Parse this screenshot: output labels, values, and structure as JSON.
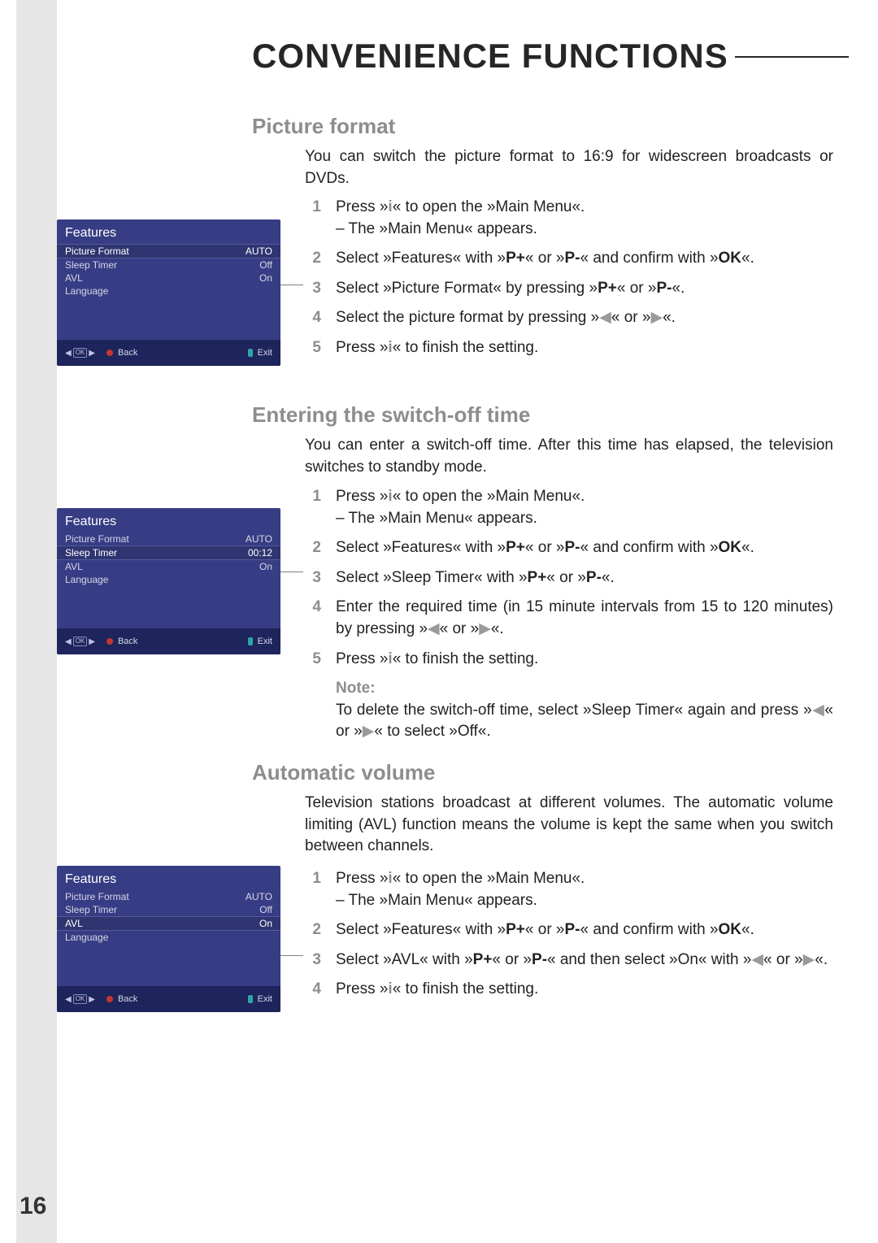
{
  "page_number": "16",
  "title": "CONVENIENCE FUNCTIONS",
  "sections": {
    "picture_format": {
      "heading": "Picture format",
      "intro": "You can switch the picture format to 16:9 for widescreen broadcasts or DVDs.",
      "steps": [
        {
          "n": "1",
          "pre": "Press »",
          "key": "i",
          "post": "« to open the »Main Menu«.",
          "sub": "– The »Main Menu« appears."
        },
        {
          "n": "2",
          "text": "Select »Features« with »P+« or »P-« and confirm with »OK«."
        },
        {
          "n": "3",
          "text": "Select »Picture Format« by pressing »P+« or »P-«."
        },
        {
          "n": "4",
          "text": "Select the picture format by pressing »◀« or »▶«."
        },
        {
          "n": "5",
          "pre": "Press »",
          "key": "i",
          "post": "« to finish the setting."
        }
      ]
    },
    "switch_off": {
      "heading": "Entering the switch-off time",
      "intro": "You can enter a switch-off time. After this time has elapsed, the television switches to standby mode.",
      "steps": [
        {
          "n": "1",
          "pre": "Press »",
          "key": "i",
          "post": "« to open the »Main Menu«.",
          "sub": "– The »Main Menu« appears."
        },
        {
          "n": "2",
          "text": "Select »Features« with »P+« or »P-« and confirm with »OK«."
        },
        {
          "n": "3",
          "text": "Select »Sleep Timer« with »P+« or »P-«."
        },
        {
          "n": "4",
          "text": "Enter the required time (in 15 minute intervals from 15 to 120 minutes) by pressing »◀« or »▶«."
        },
        {
          "n": "5",
          "pre": "Press »",
          "key": "i",
          "post": "« to finish the setting."
        }
      ],
      "note_label": "Note:",
      "note_text": "To delete the switch-off time, select »Sleep Timer« again and press »◀« or »▶« to select »Off«."
    },
    "avl": {
      "heading": "Automatic volume",
      "intro": "Television stations broadcast at different volumes. The automatic volume limiting (AVL) function means the volume is kept the same when you switch between channels.",
      "steps": [
        {
          "n": "1",
          "pre": "Press »",
          "key": "i",
          "post": "« to open the »Main Menu«.",
          "sub": "– The »Main Menu« appears."
        },
        {
          "n": "2",
          "text": "Select »Features« with »P+« or »P-« and confirm with »OK«."
        },
        {
          "n": "3",
          "text": "Select »AVL« with »P+« or »P-« and then select »On« with »◀« or »▶«."
        },
        {
          "n": "4",
          "pre": "Press »",
          "key": "i",
          "post": "« to finish the setting."
        }
      ]
    }
  },
  "osd": {
    "title": "Features",
    "rows": [
      {
        "label": "Picture Format",
        "value": "AUTO"
      },
      {
        "label": "Sleep Timer",
        "value": "Off"
      },
      {
        "label": "AVL",
        "value": "On"
      },
      {
        "label": "Language",
        "value": ""
      }
    ],
    "sleep_value_alt": "00:12",
    "back": "Back",
    "exit": "Exit"
  }
}
